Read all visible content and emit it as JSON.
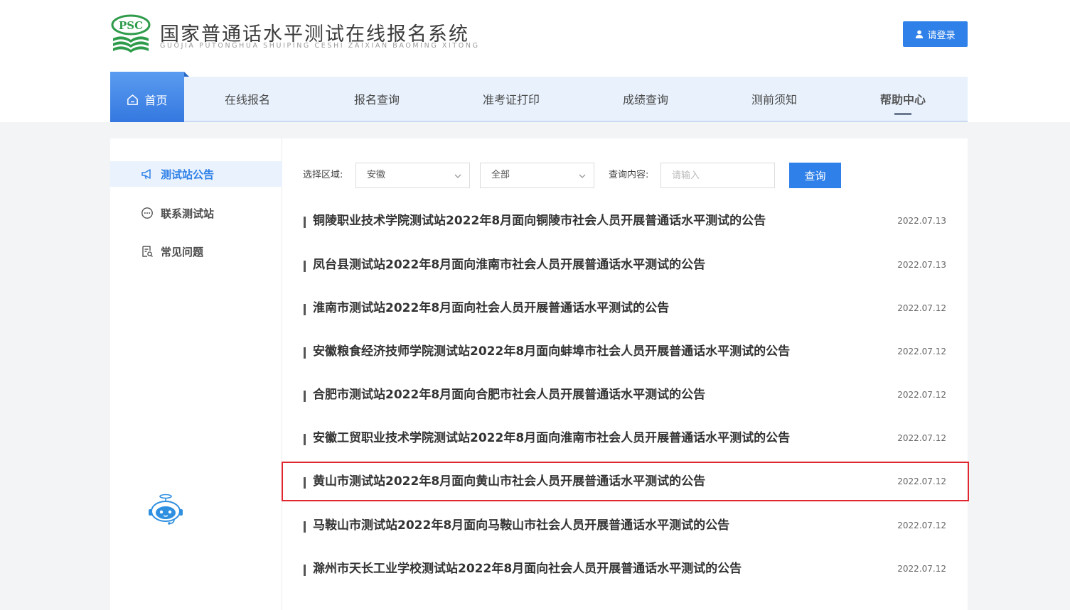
{
  "header": {
    "logo_badge": "PSC",
    "title": "国家普通话水平测试在线报名系统",
    "subtitle": "GUOJIA PUTONGHUA SHUIPING CESHI ZAIXIAN BAOMING XITONG",
    "login_label": "请登录"
  },
  "nav": {
    "items": [
      {
        "label": "首页"
      },
      {
        "label": "在线报名"
      },
      {
        "label": "报名查询"
      },
      {
        "label": "准考证打印"
      },
      {
        "label": "成绩查询"
      },
      {
        "label": "测前须知"
      },
      {
        "label": "帮助中心"
      }
    ]
  },
  "sidebar": {
    "items": [
      {
        "label": "测试站公告",
        "icon": "megaphone-icon"
      },
      {
        "label": "联系测试站",
        "icon": "chat-icon"
      },
      {
        "label": "常见问题",
        "icon": "document-search-icon"
      }
    ]
  },
  "filter": {
    "region_label": "选择区域:",
    "region_value": "安徽",
    "scope_value": "全部",
    "query_label": "查询内容:",
    "query_placeholder": "请输入",
    "query_button": "查询"
  },
  "notices": [
    {
      "title": "铜陵职业技术学院测试站2022年8月面向铜陵市社会人员开展普通话水平测试的公告",
      "date": "2022.07.13"
    },
    {
      "title": "凤台县测试站2022年8月面向淮南市社会人员开展普通话水平测试的公告",
      "date": "2022.07.13"
    },
    {
      "title": "淮南市测试站2022年8月面向社会人员开展普通话水平测试的公告",
      "date": "2022.07.12"
    },
    {
      "title": "安徽粮食经济技师学院测试站2022年8月面向蚌埠市社会人员开展普通话水平测试的公告",
      "date": "2022.07.12"
    },
    {
      "title": "合肥市测试站2022年8月面向合肥市社会人员开展普通话水平测试的公告",
      "date": "2022.07.12"
    },
    {
      "title": "安徽工贸职业技术学院测试站2022年8月面向淮南市社会人员开展普通话水平测试的公告",
      "date": "2022.07.12"
    },
    {
      "title": "黄山市测试站2022年8月面向黄山市社会人员开展普通话水平测试的公告",
      "date": "2022.07.12"
    },
    {
      "title": "马鞍山市测试站2022年8月面向马鞍山市社会人员开展普通话水平测试的公告",
      "date": "2022.07.12"
    },
    {
      "title": "滁州市天长工业学校测试站2022年8月面向社会人员开展普通话水平测试的公告",
      "date": "2022.07.12"
    }
  ],
  "colors": {
    "accent": "#2f80e8",
    "highlight": "#e0262f",
    "logo_green": "#2e9b4a"
  }
}
